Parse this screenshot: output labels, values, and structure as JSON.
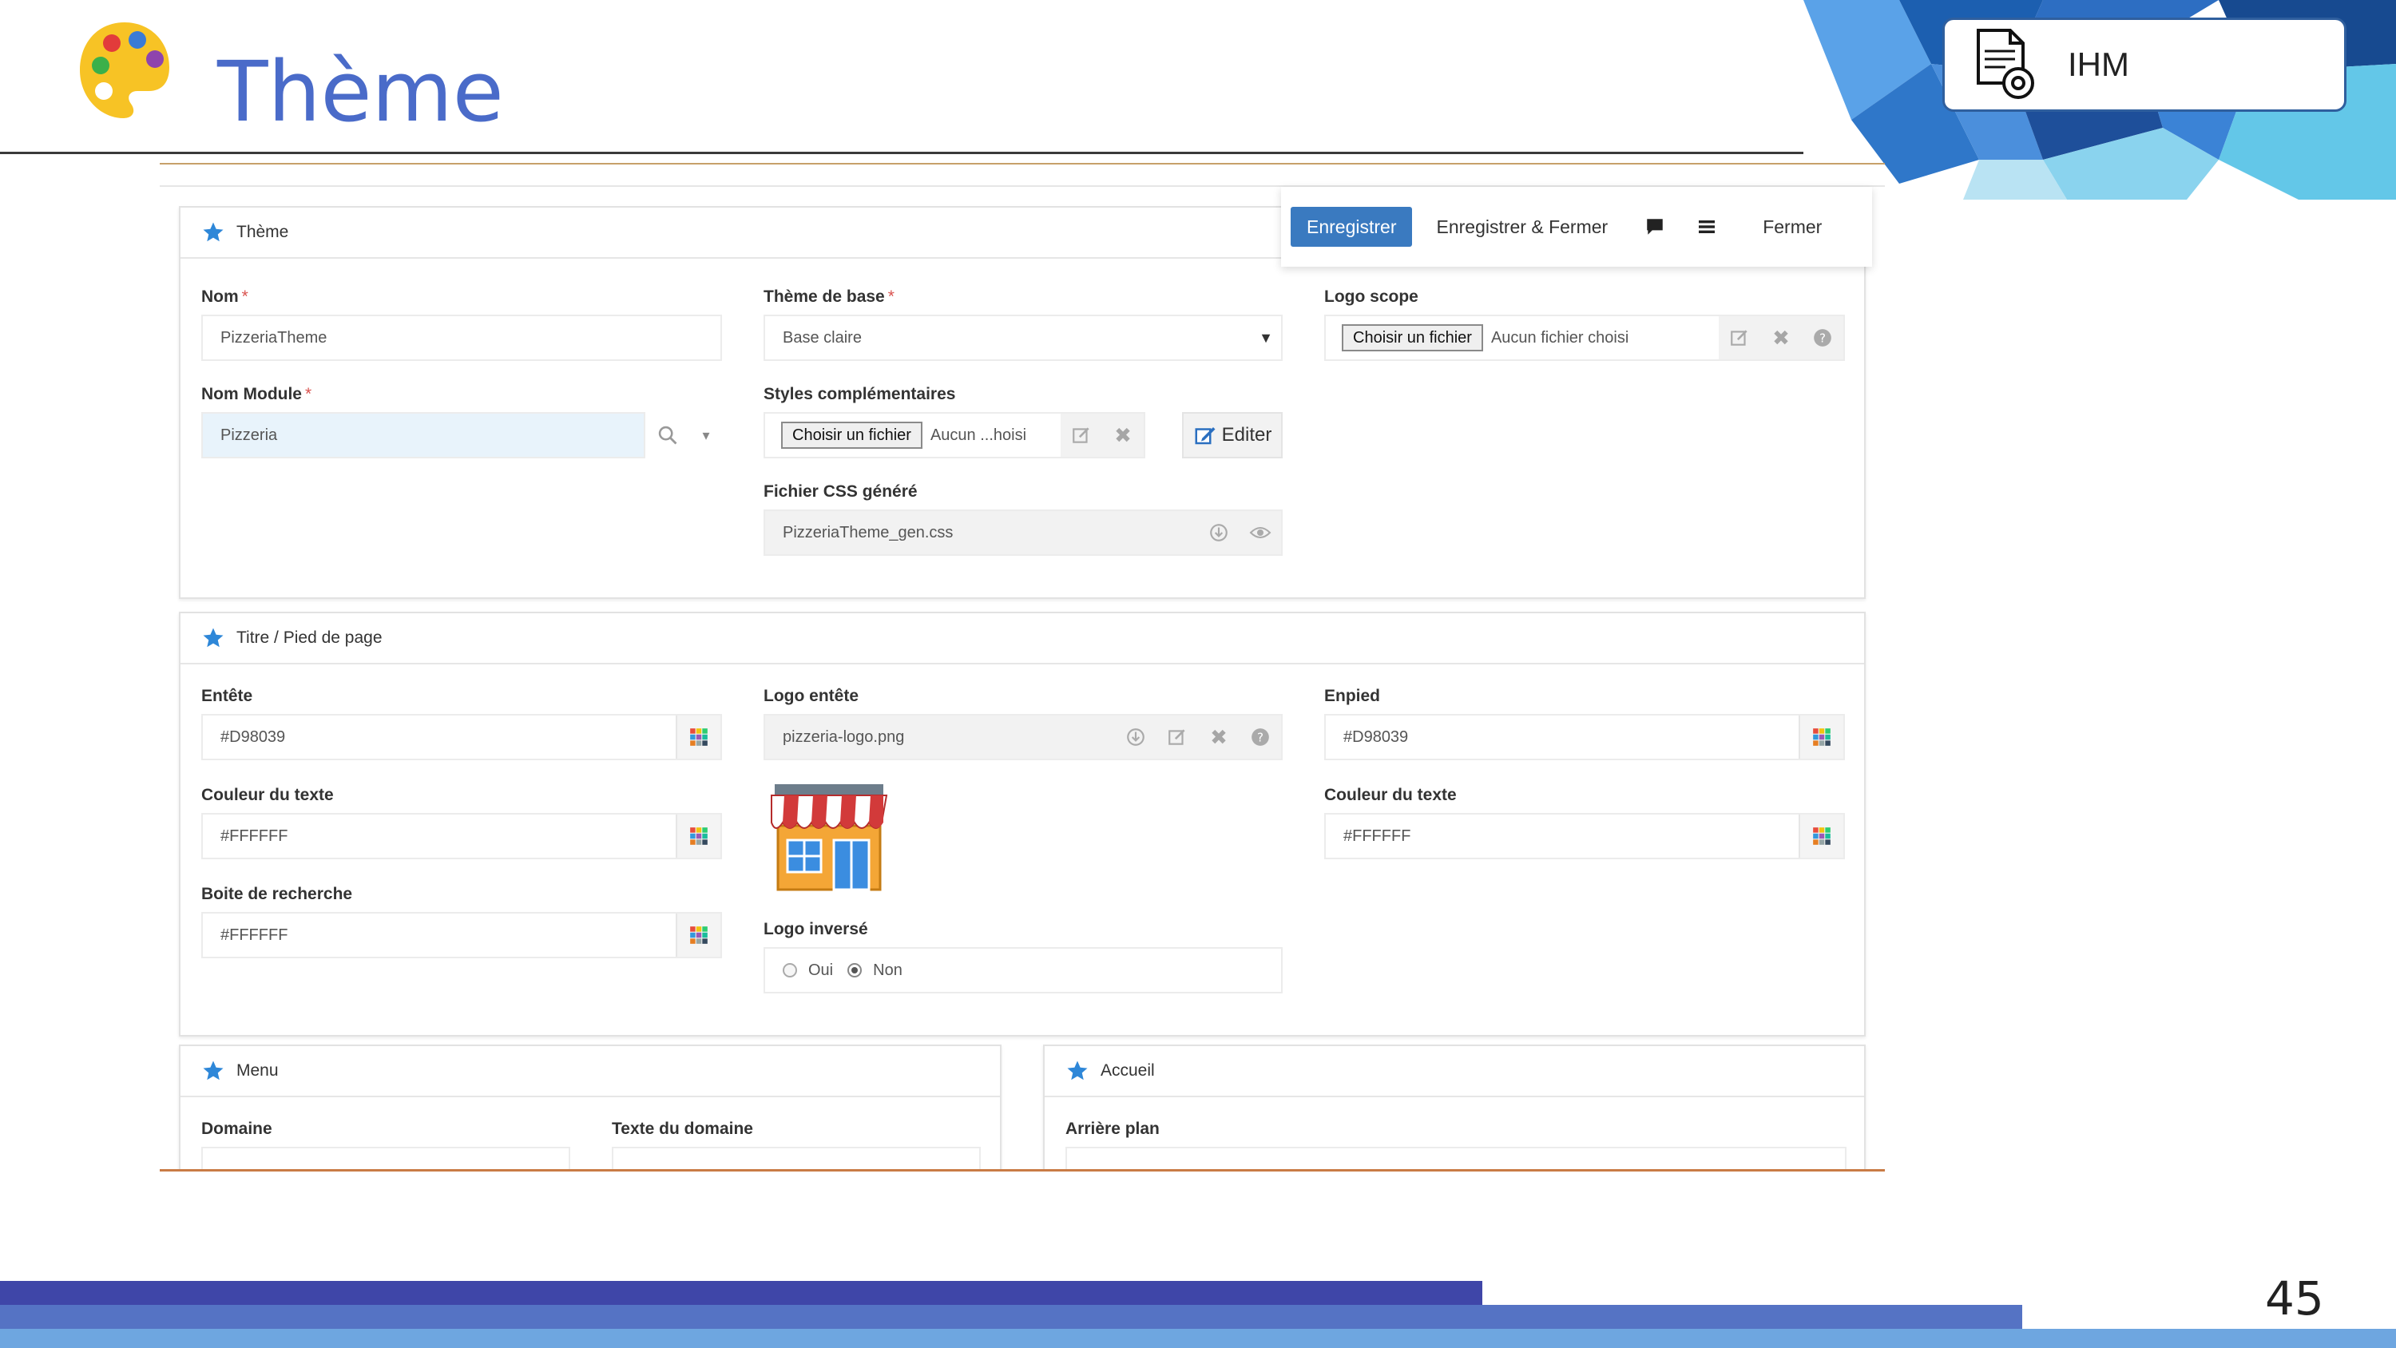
{
  "slide": {
    "title": "Thème",
    "badge": "IHM",
    "page_number": "45"
  },
  "colors": {
    "title": "#4a6bc9",
    "band_dark": "#3f46a8",
    "band_mid": "#5573c4",
    "band_light": "#6ea6e0",
    "primary_button": "#3a7ac0",
    "required": "#d9534f"
  },
  "actionbar": {
    "save": "Enregistrer",
    "save_close": "Enregistrer & Fermer",
    "close": "Fermer",
    "icons": [
      "comment-icon",
      "menu-icon"
    ]
  },
  "theme_panel": {
    "title": "Thème",
    "nom_label": "Nom",
    "nom_value": "PizzeriaTheme",
    "module_label": "Nom Module",
    "module_value": "Pizzeria",
    "base_label": "Thème de base",
    "base_value": "Base claire",
    "styles_label": "Styles complémentaires",
    "styles_file_button": "Choisir un fichier",
    "styles_file_text": "Aucun ...hoisi",
    "edit_button": "Editer",
    "css_label": "Fichier CSS généré",
    "css_value": "PizzeriaTheme_gen.css",
    "logo_scope_label": "Logo scope",
    "logo_scope_button": "Choisir un fichier",
    "logo_scope_text": "Aucun fichier choisi"
  },
  "header_panel": {
    "title": "Titre / Pied de page",
    "entete_label": "Entête",
    "entete_value": "#D98039",
    "text_color_label": "Couleur du texte",
    "text_color_value": "#FFFFFF",
    "search_label": "Boite de recherche",
    "search_value": "#FFFFFF",
    "logo_label": "Logo entête",
    "logo_value": "pizzeria-logo.png",
    "logo_inverse_label": "Logo inversé",
    "radio_yes": "Oui",
    "radio_no": "Non",
    "radio_selected": "Non",
    "enpied_label": "Enpied",
    "enpied_value": "#D98039",
    "footer_text_color_label": "Couleur du texte",
    "footer_text_color_value": "#FFFFFF"
  },
  "menu_panel": {
    "title": "Menu",
    "domain_label": "Domaine",
    "domain_text_label": "Texte du domaine"
  },
  "home_panel": {
    "title": "Accueil",
    "background_label": "Arrière plan"
  }
}
